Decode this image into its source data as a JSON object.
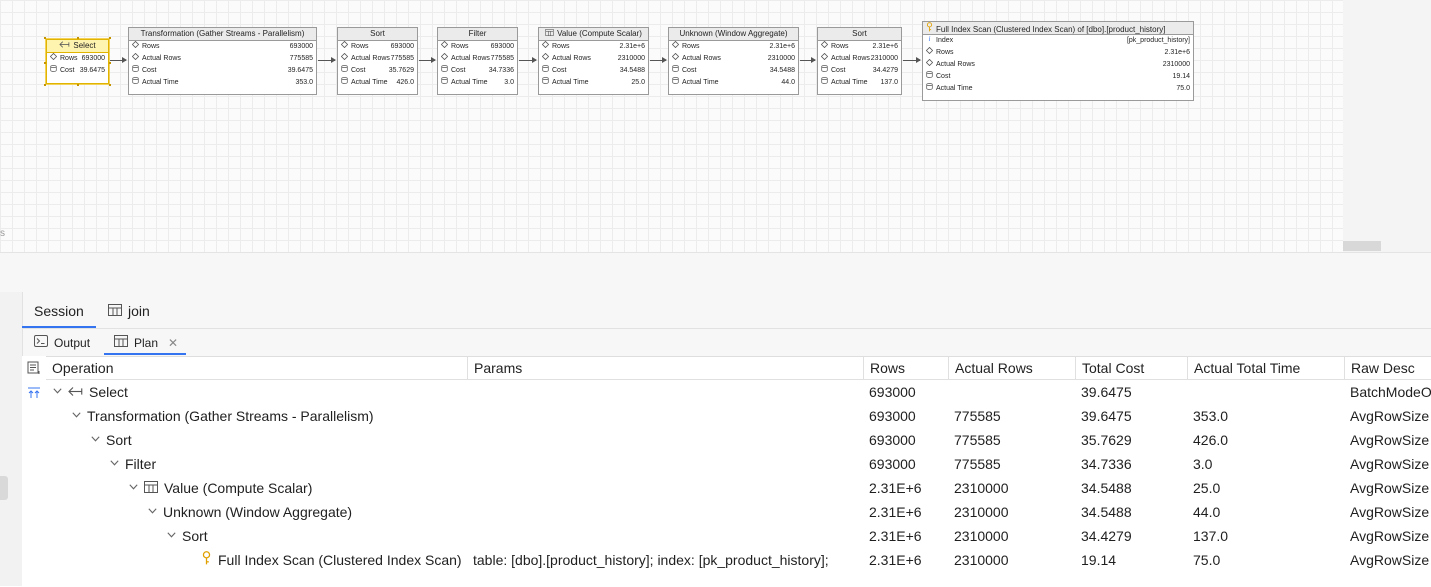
{
  "diagram": {
    "edge_letter": "s",
    "nodes": [
      {
        "title": "Select",
        "icon": "arrow-left-icon",
        "rows": [
          {
            "k": "Rows",
            "v": "693000",
            "icon": "diamond-icon"
          },
          {
            "k": "Cost",
            "v": "39.6475",
            "icon": "cylinder-icon"
          }
        ]
      },
      {
        "title": "Transformation (Gather Streams - Parallelism)",
        "rows": [
          {
            "k": "Rows",
            "v": "693000",
            "icon": "diamond-icon"
          },
          {
            "k": "Actual Rows",
            "v": "775585",
            "icon": "diamond-icon"
          },
          {
            "k": "Cost",
            "v": "39.6475",
            "icon": "cylinder-icon"
          },
          {
            "k": "Actual Time",
            "v": "353.0",
            "icon": "cylinder-icon"
          }
        ]
      },
      {
        "title": "Sort",
        "rows": [
          {
            "k": "Rows",
            "v": "693000",
            "icon": "diamond-icon"
          },
          {
            "k": "Actual Rows",
            "v": "775585",
            "icon": "diamond-icon"
          },
          {
            "k": "Cost",
            "v": "35.7629",
            "icon": "cylinder-icon"
          },
          {
            "k": "Actual Time",
            "v": "426.0",
            "icon": "cylinder-icon"
          }
        ]
      },
      {
        "title": "Filter",
        "rows": [
          {
            "k": "Rows",
            "v": "693000",
            "icon": "diamond-icon"
          },
          {
            "k": "Actual Rows",
            "v": "775585",
            "icon": "diamond-icon"
          },
          {
            "k": "Cost",
            "v": "34.7336",
            "icon": "cylinder-icon"
          },
          {
            "k": "Actual Time",
            "v": "3.0",
            "icon": "cylinder-icon"
          }
        ]
      },
      {
        "title": "Value (Compute Scalar)",
        "icon": "table-icon",
        "rows": [
          {
            "k": "Rows",
            "v": "2.31e+6",
            "icon": "diamond-icon"
          },
          {
            "k": "Actual Rows",
            "v": "2310000",
            "icon": "diamond-icon"
          },
          {
            "k": "Cost",
            "v": "34.5488",
            "icon": "cylinder-icon"
          },
          {
            "k": "Actual Time",
            "v": "25.0",
            "icon": "cylinder-icon"
          }
        ]
      },
      {
        "title": "Unknown (Window Aggregate)",
        "rows": [
          {
            "k": "Rows",
            "v": "2.31e+6",
            "icon": "diamond-icon"
          },
          {
            "k": "Actual Rows",
            "v": "2310000",
            "icon": "diamond-icon"
          },
          {
            "k": "Cost",
            "v": "34.5488",
            "icon": "cylinder-icon"
          },
          {
            "k": "Actual Time",
            "v": "44.0",
            "icon": "cylinder-icon"
          }
        ]
      },
      {
        "title": "Sort",
        "rows": [
          {
            "k": "Rows",
            "v": "2.31e+6",
            "icon": "diamond-icon"
          },
          {
            "k": "Actual Rows",
            "v": "2310000",
            "icon": "diamond-icon"
          },
          {
            "k": "Cost",
            "v": "34.4279",
            "icon": "cylinder-icon"
          },
          {
            "k": "Actual Time",
            "v": "137.0",
            "icon": "cylinder-icon"
          }
        ]
      },
      {
        "title": "Full Index Scan (Clustered Index Scan) of [dbo].[product_history]",
        "icon": "key-icon",
        "rows": [
          {
            "k": "Index",
            "v": "[pk_product_history]",
            "icon": "info-icon"
          },
          {
            "k": "Rows",
            "v": "2.31e+6",
            "icon": "diamond-icon"
          },
          {
            "k": "Actual Rows",
            "v": "2310000",
            "icon": "diamond-icon"
          },
          {
            "k": "Cost",
            "v": "19.14",
            "icon": "cylinder-icon"
          },
          {
            "k": "Actual Time",
            "v": "75.0",
            "icon": "cylinder-icon"
          }
        ]
      }
    ]
  },
  "tabs": {
    "session": "Session",
    "join": "join",
    "output": "Output",
    "plan": "Plan"
  },
  "table": {
    "columns": [
      "Operation",
      "Params",
      "Rows",
      "Actual Rows",
      "Total Cost",
      "Actual Total Time",
      "Raw Desc"
    ],
    "rows": [
      {
        "depth": 0,
        "icon": "arrow-left-icon",
        "op": "Select",
        "params": "",
        "rows": "693000",
        "actual_rows": "",
        "total_cost": "39.6475",
        "actual_time": "",
        "raw": "BatchModeO"
      },
      {
        "depth": 1,
        "icon": "",
        "op": "Transformation (Gather Streams - Parallelism)",
        "params": "",
        "rows": "693000",
        "actual_rows": "775585",
        "total_cost": "39.6475",
        "actual_time": "353.0",
        "raw": "AvgRowSize"
      },
      {
        "depth": 2,
        "icon": "",
        "op": "Sort",
        "params": "",
        "rows": "693000",
        "actual_rows": "775585",
        "total_cost": "35.7629",
        "actual_time": "426.0",
        "raw": "AvgRowSize"
      },
      {
        "depth": 3,
        "icon": "",
        "op": "Filter",
        "params": "",
        "rows": "693000",
        "actual_rows": "775585",
        "total_cost": "34.7336",
        "actual_time": "3.0",
        "raw": "AvgRowSize"
      },
      {
        "depth": 4,
        "icon": "table-icon",
        "op": "Value (Compute Scalar)",
        "params": "",
        "rows": "2.31E+6",
        "actual_rows": "2310000",
        "total_cost": "34.5488",
        "actual_time": "25.0",
        "raw": "AvgRowSize"
      },
      {
        "depth": 5,
        "icon": "",
        "op": "Unknown (Window Aggregate)",
        "params": "",
        "rows": "2.31E+6",
        "actual_rows": "2310000",
        "total_cost": "34.5488",
        "actual_time": "44.0",
        "raw": "AvgRowSize"
      },
      {
        "depth": 6,
        "icon": "",
        "op": "Sort",
        "params": "",
        "rows": "2.31E+6",
        "actual_rows": "2310000",
        "total_cost": "34.4279",
        "actual_time": "137.0",
        "raw": "AvgRowSize"
      },
      {
        "depth": 7,
        "icon": "key-icon",
        "op": "Full Index Scan (Clustered Index Scan)",
        "params": "table: [dbo].[product_history]; index: [pk_product_history];",
        "rows": "2.31E+6",
        "actual_rows": "2310000",
        "total_cost": "19.14",
        "actual_time": "75.0",
        "raw": "AvgRowSize",
        "leaf": true
      }
    ]
  },
  "colors": {
    "accent": "#3574f0",
    "selected_border": "#e0b400",
    "key_icon": "#e0a000"
  }
}
